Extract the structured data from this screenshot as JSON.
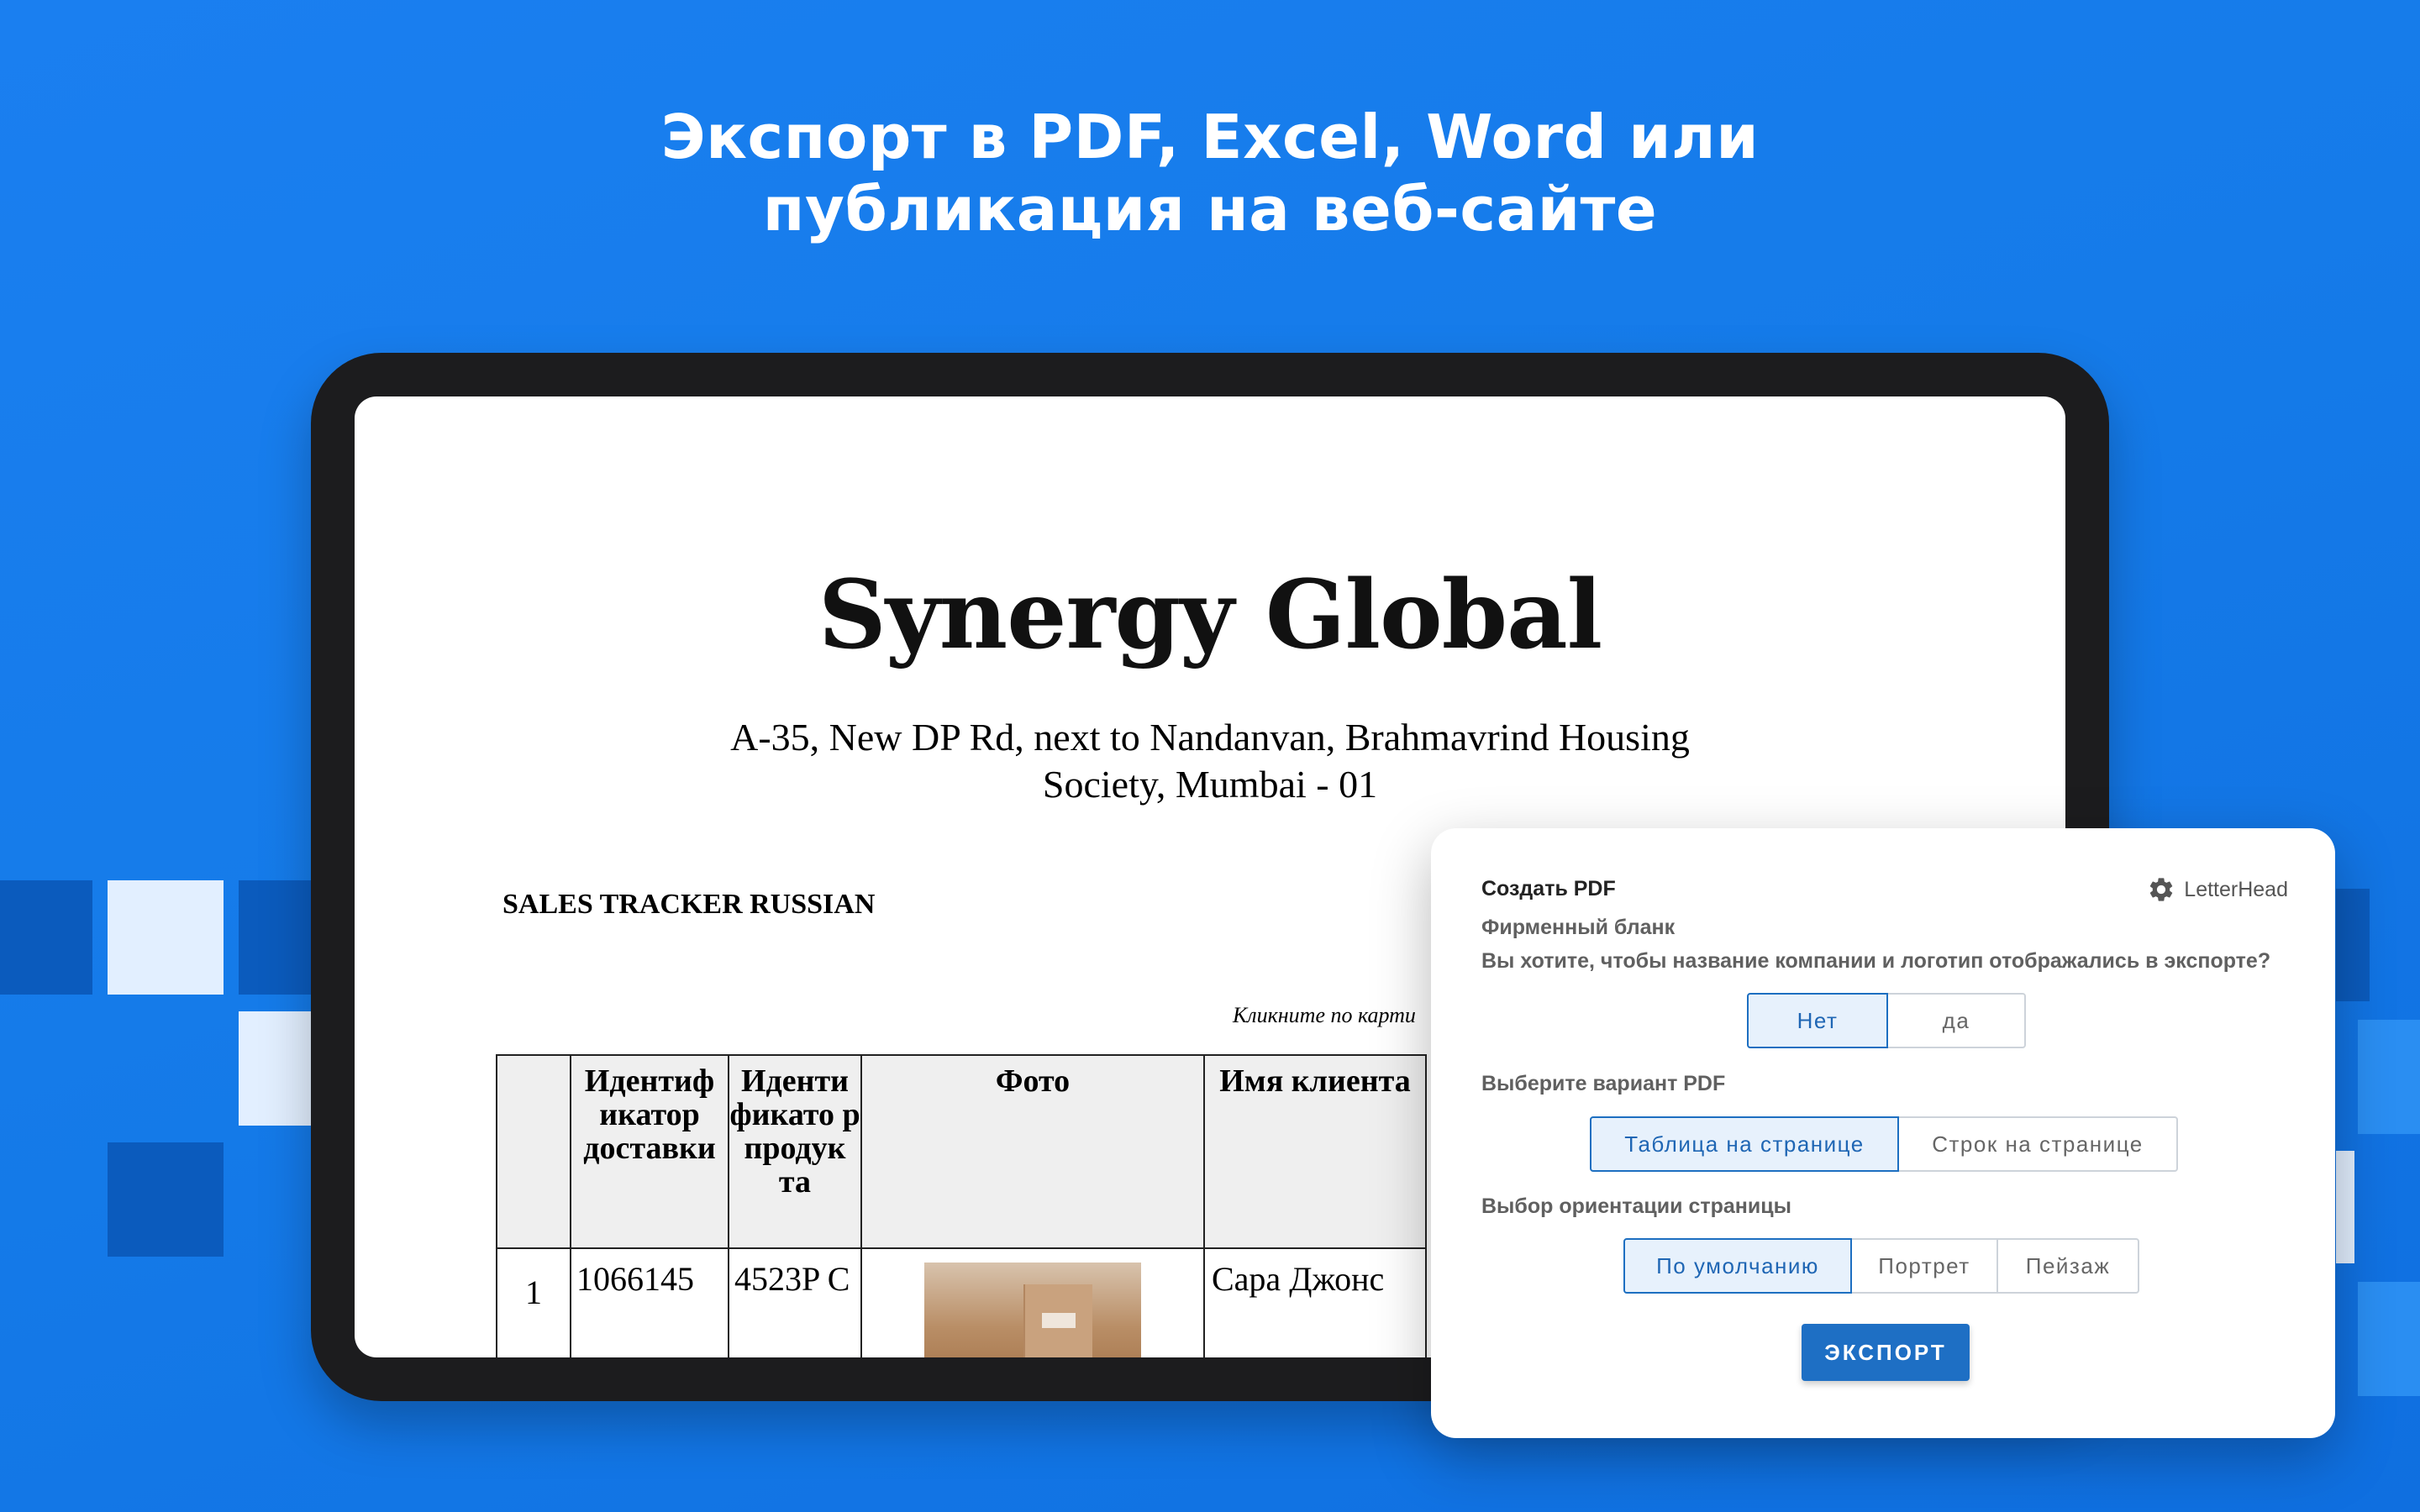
{
  "headline": {
    "line1": "Экспорт в PDF, Excel, Word или",
    "line2": "публикация на веб-сайте"
  },
  "document": {
    "company": "Synergy Global",
    "address_line1": "A-35,  New DP Rd, next to Nandanvan, Brahmavrind Housing",
    "address_line2": "Society, Mumbai - 01",
    "report_title": "SALES TRACKER RUSSIAN",
    "click_hint": "Кликните по карти",
    "table": {
      "headers": [
        "",
        "Идентиф икатор доставки",
        "Иденти фикато р продук та",
        "Фото",
        "Имя клиента"
      ],
      "rows": [
        {
          "index": "1",
          "delivery_id": "1066145",
          "product_id": "4523P C",
          "customer": "Сара Джонс"
        }
      ]
    }
  },
  "dialog": {
    "title": "Создать PDF",
    "letterhead_link": "LetterHead",
    "letterhead_label": "Фирменный бланк",
    "letterhead_question": "Вы хотите, чтобы название компании и логотип отображались в экспорте?",
    "letterhead_options": [
      "Нет",
      "да"
    ],
    "letterhead_selected": "Нет",
    "variant_label": "Выберите вариант PDF",
    "variant_options": [
      "Таблица на странице",
      "Строк на странице"
    ],
    "variant_selected": "Таблица на странице",
    "orientation_label": "Выбор ориентации страницы",
    "orientation_options": [
      "По умолчанию",
      "Портрет",
      "Пейзаж"
    ],
    "orientation_selected": "По умолчанию",
    "export_label": "ЭКСПОРТ"
  },
  "colors": {
    "background": "#1a7ff0",
    "accent": "#1e6fc4",
    "tablet_bezel": "#1c1c1e"
  }
}
